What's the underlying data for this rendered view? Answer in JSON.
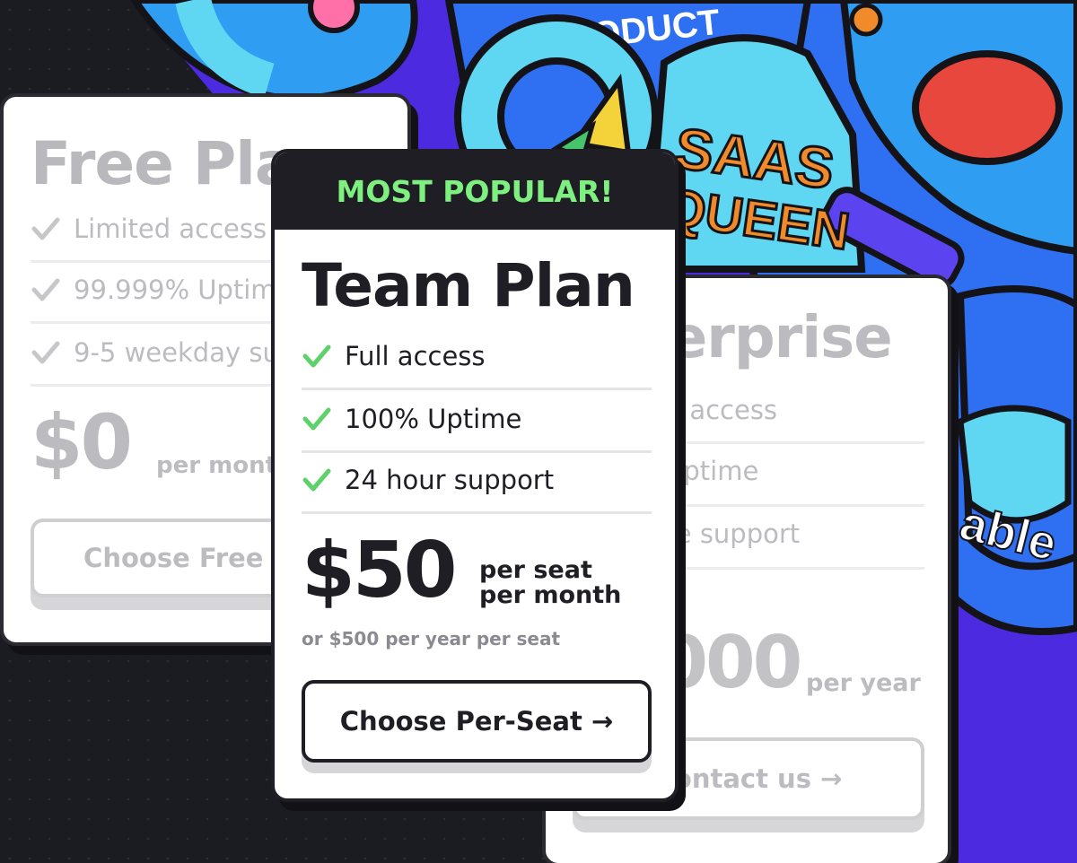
{
  "colors": {
    "accent_green": "#7ef07f",
    "card_border": "#1e1e24",
    "background_purple": "#4b2ae0",
    "sticker_blue": "#2f6ff2",
    "sticker_cyan": "#5fd6f2",
    "sticker_orange": "#f08a2a",
    "faded_text": "#bcbcc0"
  },
  "background": {
    "sticker_product_text": "ODUCT",
    "sticker_saas_line1": "SAAS",
    "sticker_saas_line2": "QUEEN",
    "sticker_able_text": "able"
  },
  "free_plan": {
    "title": "Free Plan",
    "features": [
      "Limited access",
      "99.999% Uptime",
      "9-5 weekday support"
    ],
    "price": "$0",
    "price_unit": "per month",
    "button_label": "Choose Free Plan"
  },
  "team_plan": {
    "banner": "MOST POPULAR!",
    "title": "Team Plan",
    "features": [
      "Full access",
      "100% Uptime",
      "24 hour support"
    ],
    "price": "$50",
    "price_unit_line1": "per seat",
    "price_unit_line2": "per month",
    "price_alt": "or $500 per year per seat",
    "button_label": "Choose Per-Seat →"
  },
  "enterprise_plan": {
    "title": "Enterprise",
    "features": [
      "Custom access",
      "100% Uptime",
      "Bespoke support"
    ],
    "price": "$5000",
    "price_unit": "per year",
    "button_label": "Contact us →"
  },
  "icons": [
    "check-icon",
    "arrow-right-icon"
  ]
}
